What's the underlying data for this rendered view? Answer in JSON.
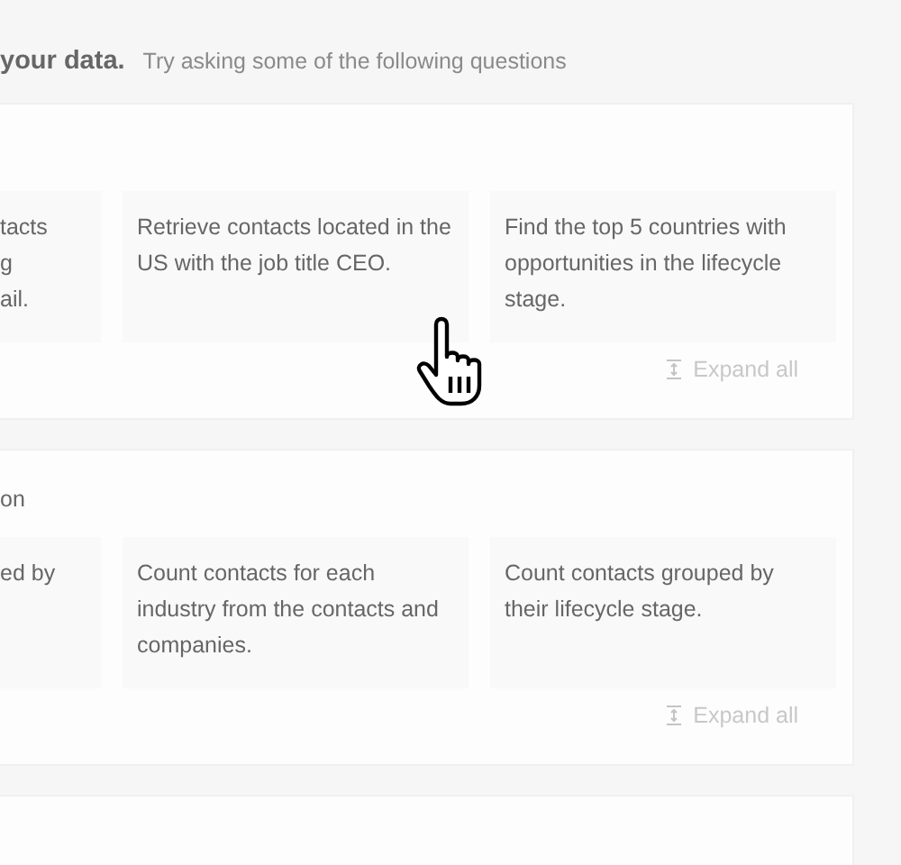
{
  "header": {
    "title": "your data.",
    "hint": "Try asking some of the following questions"
  },
  "sections": [
    {
      "questions": [
        {
          "kind": "clipped",
          "text": "tacts\ng\nail."
        },
        {
          "kind": "full",
          "text": "Retrieve contacts located in the US with the job title CEO."
        },
        {
          "kind": "full",
          "text": "Find the top 5 countries with opportunities in the lifecycle stage."
        }
      ],
      "expand_label": "Expand all"
    },
    {
      "title": "on",
      "questions": [
        {
          "kind": "clipped",
          "text": "ed by"
        },
        {
          "kind": "full",
          "text": "Count contacts for each industry from the contacts and companies."
        },
        {
          "kind": "full",
          "text": "Count contacts grouped by their lifecycle stage."
        }
      ],
      "expand_label": "Expand all"
    }
  ]
}
